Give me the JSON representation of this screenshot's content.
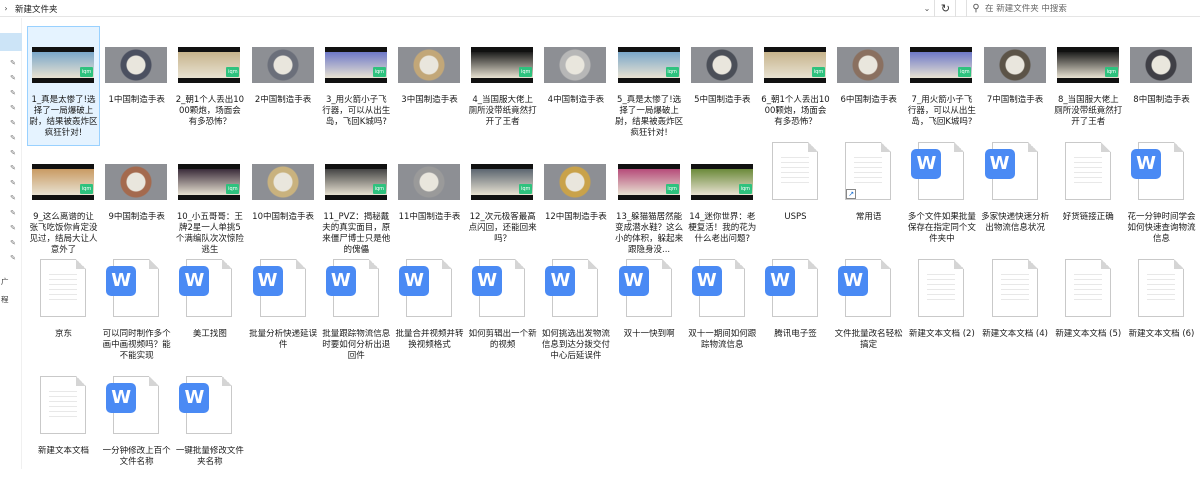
{
  "address": {
    "path": "新建文件夹"
  },
  "search": {
    "placeholder": "在 新建文件夹 中搜索"
  },
  "left_pane": {
    "frag1": "广",
    "frag2": "程"
  },
  "items": [
    {
      "label": "1_真是太惨了!选择了一局爆破上尉，结果被轰炸区疯狂针对!",
      "kind": "video",
      "color": "#7aa7c9"
    },
    {
      "label": "1中国制造手表",
      "kind": "photo",
      "color": "#4b5060"
    },
    {
      "label": "2_朝1个人丢出1000颗炮，场面会有多恐怖？",
      "kind": "video",
      "color": "#c7b48c"
    },
    {
      "label": "2中国制造手表",
      "kind": "photo",
      "color": "#6b6f7a"
    },
    {
      "label": "3_用火箭小子飞行器，可以从出生岛，飞回K城吗?",
      "kind": "video",
      "color": "#6d78c8"
    },
    {
      "label": "3中国制造手表",
      "kind": "photo",
      "color": "#c2a778"
    },
    {
      "label": "4_当国服大佬上厕所没带纸竟然打开了王者",
      "kind": "video",
      "color": "#1d1d1d"
    },
    {
      "label": "4中国制造手表",
      "kind": "photo",
      "color": "#b7b7b7"
    },
    {
      "label": "5_真是太惨了!选择了一局爆破上尉，结果被轰炸区疯狂针对!",
      "kind": "video",
      "color": "#7aa7c9"
    },
    {
      "label": "5中国制造手表",
      "kind": "photo",
      "color": "#4b4f58"
    },
    {
      "label": "6_朝1个人丢出1000颗炮，场面会有多恐怖？",
      "kind": "video",
      "color": "#c7b48c"
    },
    {
      "label": "6中国制造手表",
      "kind": "photo",
      "color": "#8a7060"
    },
    {
      "label": "7_用火箭小子飞行器，可以从出生岛，飞回K城吗?",
      "kind": "video",
      "color": "#6d78c8"
    },
    {
      "label": "7中国制造手表",
      "kind": "photo",
      "color": "#5c5448"
    },
    {
      "label": "8_当国服大佬上厕所没带纸竟然打开了王者",
      "kind": "video",
      "color": "#1d1d1d"
    },
    {
      "label": "8中国制造手表",
      "kind": "photo",
      "color": "#3f3f46"
    },
    {
      "label": "9_这么离谱的让张飞吃饭你肯定没见过，结局大让人意外了",
      "kind": "video",
      "color": "#c99b63"
    },
    {
      "label": "9中国制造手表",
      "kind": "photo",
      "color": "#a46a4e"
    },
    {
      "label": "10_小五哥哥：王牌2星一人单挑5个满编队次次惊险逃生",
      "kind": "video",
      "color": "#3a2c3a"
    },
    {
      "label": "10中国制造手表",
      "kind": "photo",
      "color": "#c9b27e"
    },
    {
      "label": "11_PVZ：揭秘戴夫的真实面目，原来僵尸博士只是他的傀儡",
      "kind": "video",
      "color": "#444444"
    },
    {
      "label": "11中国制造手表",
      "kind": "photo",
      "color": "#9a9a9a"
    },
    {
      "label": "12_次元极客最高点闪回，还能回来吗？",
      "kind": "video",
      "color": "#5b6570"
    },
    {
      "label": "12中国制造手表",
      "kind": "photo",
      "color": "#c9a24a"
    },
    {
      "label": "13_躲猫猫居然能变成潜水鞋？这么小的体积，躲起来跟隐身没...",
      "kind": "video",
      "color": "#b64b7a"
    },
    {
      "label": "14_迷你世界：老梗复活！我的花为什么老出问题?",
      "kind": "video",
      "color": "#6b8a3a"
    },
    {
      "label": "USPS",
      "kind": "doc"
    },
    {
      "label": "常用语",
      "kind": "doc-shortcut"
    },
    {
      "label": "多个文件如果批量保存在指定同个文件夹中",
      "kind": "wdoc"
    },
    {
      "label": "多家快递快速分析出物流信息状况",
      "kind": "wdoc"
    },
    {
      "label": "好货链接正确",
      "kind": "doc"
    },
    {
      "label": "花一分钟时间学会如何快速查询物流信息",
      "kind": "wdoc"
    },
    {
      "label": "京东",
      "kind": "doc"
    },
    {
      "label": "可以同时制作多个画中画视频吗？能不能实现",
      "kind": "wdoc"
    },
    {
      "label": "美工找图",
      "kind": "wdoc"
    },
    {
      "label": "批量分析快递延误件",
      "kind": "wdoc"
    },
    {
      "label": "批量跟踪物流信息时要如何分析出退回件",
      "kind": "wdoc"
    },
    {
      "label": "批量合并视频并转换视频格式",
      "kind": "wdoc"
    },
    {
      "label": "如何剪辑出一个新的视频",
      "kind": "wdoc"
    },
    {
      "label": "如何挑选出发物流信息到达分拨交付中心后延误件",
      "kind": "wdoc"
    },
    {
      "label": "双十一快到啊",
      "kind": "wdoc"
    },
    {
      "label": "双十一期间如何跟踪物流信息",
      "kind": "wdoc"
    },
    {
      "label": "腾讯电子签",
      "kind": "wdoc"
    },
    {
      "label": "文件批量改名轻松搞定",
      "kind": "wdoc"
    },
    {
      "label": "新建文本文档 (2)",
      "kind": "doc"
    },
    {
      "label": "新建文本文档 (4)",
      "kind": "doc"
    },
    {
      "label": "新建文本文档 (5)",
      "kind": "doc"
    },
    {
      "label": "新建文本文档 (6)",
      "kind": "doc"
    },
    {
      "label": "新建文本文档",
      "kind": "doc"
    },
    {
      "label": "一分钟修改上百个文件名称",
      "kind": "wdoc"
    },
    {
      "label": "一键批量修改文件夹名称",
      "kind": "wdoc"
    }
  ]
}
